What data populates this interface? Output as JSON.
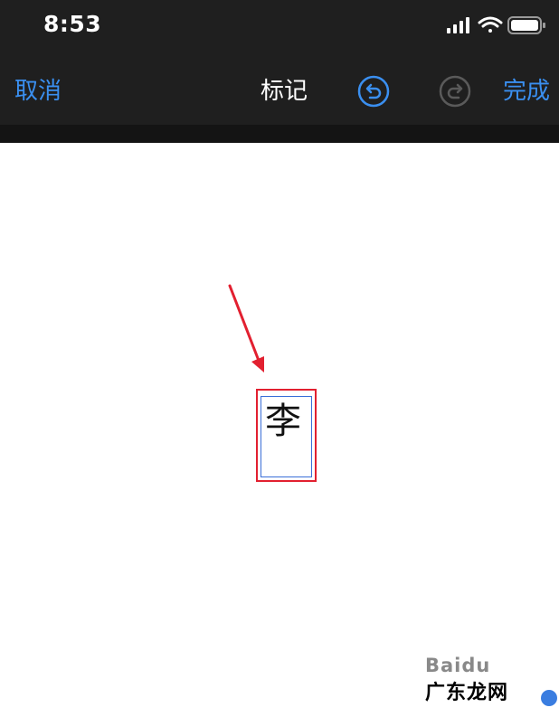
{
  "status_bar": {
    "time": "8:53",
    "icons": [
      "signal-icon",
      "wifi-icon",
      "battery-icon"
    ]
  },
  "nav_bar": {
    "cancel_label": "取消",
    "title": "标记",
    "done_label": "完成",
    "undo_icon": "undo-icon",
    "redo_icon": "redo-icon"
  },
  "canvas": {
    "character": "李"
  },
  "watermark": {
    "line1": "Baidu",
    "line2": "广东龙网"
  },
  "colors": {
    "accent": "#3a8ff0",
    "highlight": "#e22030",
    "bar_bg": "#1f1f1f"
  }
}
